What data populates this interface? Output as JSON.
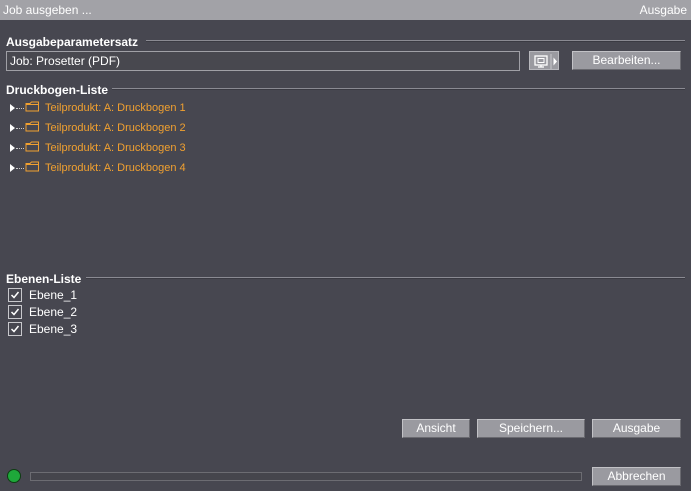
{
  "titlebar": {
    "left": "Job ausgeben ...",
    "right": "Ausgabe"
  },
  "ausgabeparametersatz": {
    "title": "Ausgabeparametersatz",
    "value": "Job: Prosetter (PDF)",
    "edit_button": "Bearbeiten..."
  },
  "druckbogen": {
    "title": "Druckbogen-Liste",
    "items": [
      {
        "label": "Teilprodukt: A: Druckbogen 1"
      },
      {
        "label": "Teilprodukt: A: Druckbogen 2"
      },
      {
        "label": "Teilprodukt: A: Druckbogen 3"
      },
      {
        "label": "Teilprodukt: A: Druckbogen 4"
      }
    ]
  },
  "ebenen": {
    "title": "Ebenen-Liste",
    "items": [
      {
        "label": "Ebene_1",
        "checked": true
      },
      {
        "label": "Ebene_2",
        "checked": true
      },
      {
        "label": "Ebene_3",
        "checked": true
      }
    ]
  },
  "buttons": {
    "ansicht": "Ansicht",
    "speichern": "Speichern...",
    "ausgabe": "Ausgabe",
    "abbrechen": "Abbrechen"
  },
  "colors": {
    "background": "#474750",
    "titlebar": "#a2a2a7",
    "tree_label": "#f0a030",
    "status_ok": "#1ea83a"
  },
  "icons": {
    "status": "green-status-dot",
    "tree": "folder-icon",
    "dropdown": "monitor-dropdown-icon"
  },
  "progress": {
    "value": 0
  }
}
